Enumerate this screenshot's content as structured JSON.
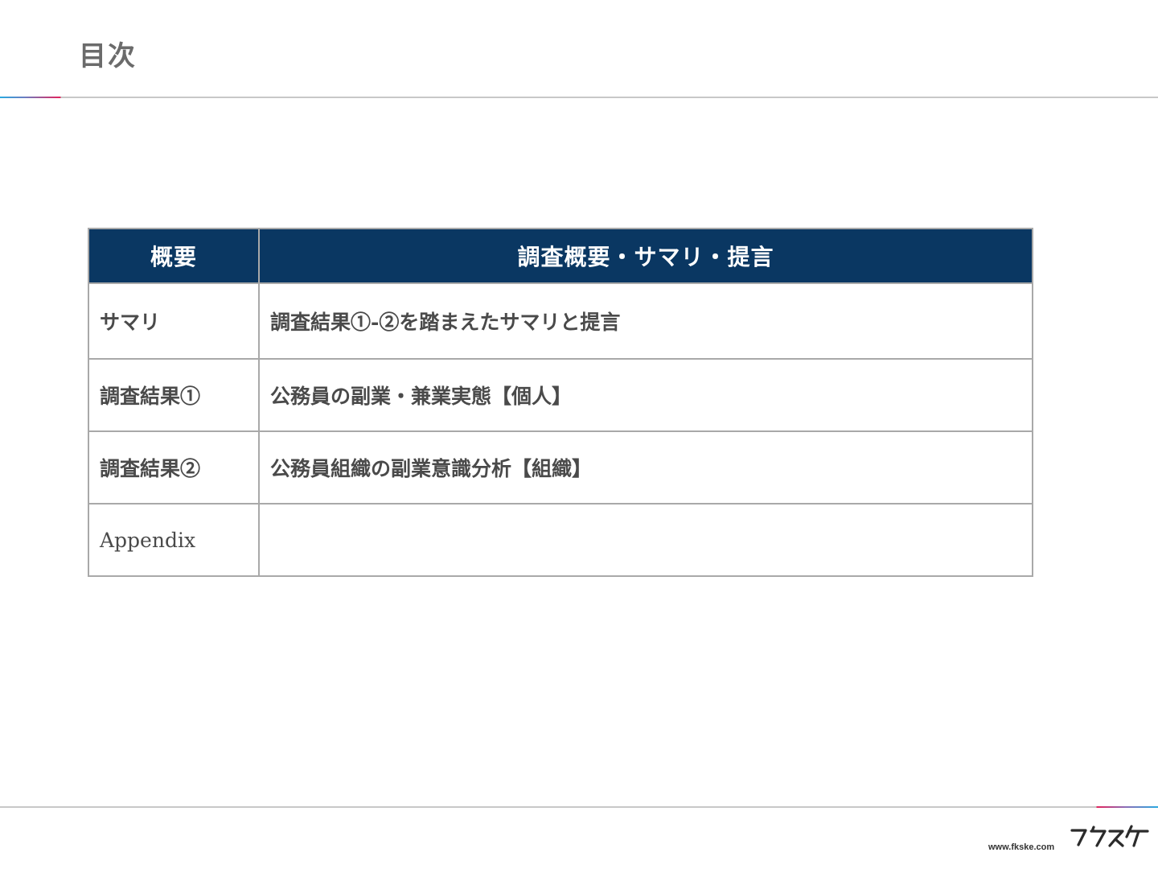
{
  "page": {
    "title": "目次"
  },
  "table": {
    "headers": [
      "概要",
      "調査概要・サマリ・提言"
    ],
    "rows": [
      {
        "label": "サマリ",
        "description": "調査結果①-②を踏まえたサマリと提言"
      },
      {
        "label": "調査結果①",
        "description": "公務員の副業・兼業実態【個人】"
      },
      {
        "label": "調査結果②",
        "description": "公務員組織の副業意識分析【組織】"
      },
      {
        "label": "Appendix",
        "description": ""
      }
    ]
  },
  "footer": {
    "url": "www.fkske.com",
    "logo_icon": "fukusuke-logo"
  },
  "colors": {
    "header_bg": "#0a3762",
    "accent_pink": "#e2245d",
    "accent_blue": "#29a9e0"
  }
}
